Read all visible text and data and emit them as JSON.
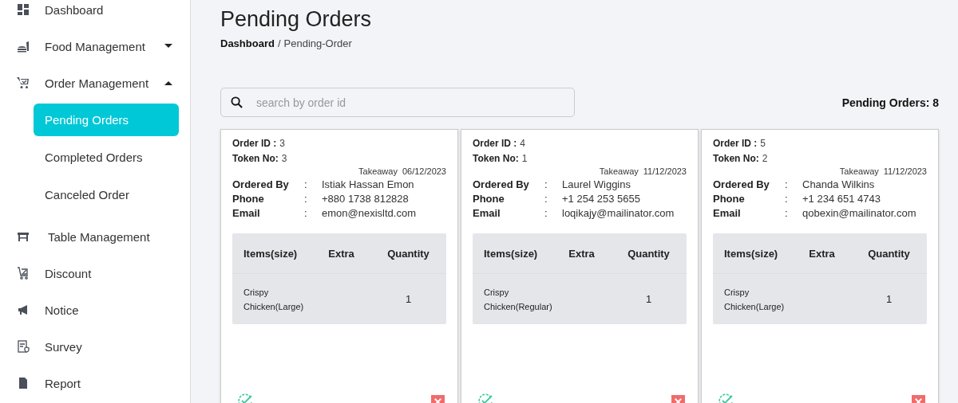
{
  "sidebar": {
    "items": [
      {
        "label": "Dashboard"
      },
      {
        "label": "Food Management",
        "expanded": false
      },
      {
        "label": "Order Management",
        "expanded": true,
        "children": [
          {
            "label": "Pending Orders",
            "selected": true
          },
          {
            "label": "Completed Orders",
            "selected": false
          },
          {
            "label": "Canceled Order",
            "selected": false
          }
        ]
      },
      {
        "label": "Table Management"
      },
      {
        "label": "Discount"
      },
      {
        "label": "Notice"
      },
      {
        "label": "Survey"
      },
      {
        "label": "Report"
      }
    ]
  },
  "page": {
    "title": "Pending Orders",
    "breadcrumb": {
      "root": "Dashboard",
      "separator": "/",
      "current": "Pending-Order"
    }
  },
  "search": {
    "placeholder": "search by order id"
  },
  "pending_count": {
    "label": "Pending Orders:",
    "value": "8"
  },
  "orders": [
    {
      "order_id_label": "Order ID :",
      "order_id": "3",
      "token_label": "Token No:",
      "token": "3",
      "type": "Takeaway",
      "date": "06/12/2023",
      "fields": [
        {
          "label": "Ordered By",
          "sep": ":",
          "value": "Istiak Hassan Emon"
        },
        {
          "label": "Phone",
          "sep": ":",
          "value": "+880 1738 812828"
        },
        {
          "label": "Email",
          "sep": ":",
          "value": "emon@nexisltd.com"
        }
      ],
      "columns": [
        "Items(size)",
        "Extra",
        "Quantity"
      ],
      "items": [
        {
          "name": "Crispy Chicken(Large)",
          "quantity": "1"
        }
      ]
    },
    {
      "order_id_label": "Order ID :",
      "order_id": "4",
      "token_label": "Token No:",
      "token": "1",
      "type": "Takeaway",
      "date": "11/12/2023",
      "fields": [
        {
          "label": "Ordered By",
          "sep": ":",
          "value": "Laurel Wiggins"
        },
        {
          "label": "Phone",
          "sep": ":",
          "value": "+1 254 253 5655"
        },
        {
          "label": "Email",
          "sep": ":",
          "value": "loqikajy@mailinator.com"
        }
      ],
      "columns": [
        "Items(size)",
        "Extra",
        "Quantity"
      ],
      "items": [
        {
          "name": "Crispy Chicken(Regular)",
          "quantity": "1"
        }
      ]
    },
    {
      "order_id_label": "Order ID :",
      "order_id": "5",
      "token_label": "Token No:",
      "token": "2",
      "type": "Takeaway",
      "date": "11/12/2023",
      "fields": [
        {
          "label": "Ordered By",
          "sep": ":",
          "value": "Chanda Wilkins"
        },
        {
          "label": "Phone",
          "sep": ":",
          "value": "+1 234 651 4743"
        },
        {
          "label": "Email",
          "sep": ":",
          "value": "qobexin@mailinator.com"
        }
      ],
      "columns": [
        "Items(size)",
        "Extra",
        "Quantity"
      ],
      "items": [
        {
          "name": "Crispy Chicken(Large)",
          "quantity": "1"
        }
      ]
    }
  ]
}
